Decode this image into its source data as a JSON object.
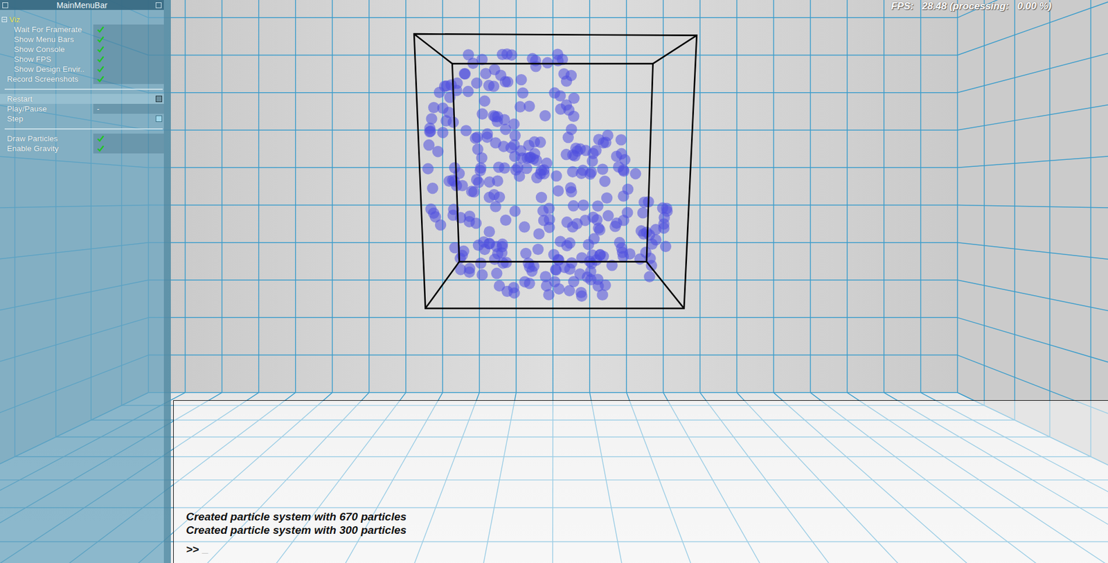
{
  "panel": {
    "title": "MainMenuBar"
  },
  "viz": {
    "label": "Viz",
    "expanded": true,
    "items": [
      {
        "label": "Wait For Framerate",
        "kind": "checkbox",
        "checked": true
      },
      {
        "label": "Show Menu Bars",
        "kind": "checkbox",
        "checked": true
      },
      {
        "label": "Show Console",
        "kind": "checkbox",
        "checked": true
      },
      {
        "label": "Show FPS",
        "kind": "checkbox",
        "checked": true
      },
      {
        "label": "Show Design Envir..",
        "kind": "checkbox",
        "checked": true
      }
    ]
  },
  "items": [
    {
      "label": "Record Screenshots",
      "kind": "checkbox",
      "checked": true
    },
    {
      "kind": "separator"
    },
    {
      "label": "Restart",
      "kind": "button",
      "highlighted": true
    },
    {
      "label": "Play/Pause",
      "kind": "field",
      "value": "-"
    },
    {
      "label": "Step",
      "kind": "button",
      "highlighted": false
    },
    {
      "kind": "separator"
    },
    {
      "label": "Draw Particles",
      "kind": "checkbox",
      "checked": true
    },
    {
      "label": "Enable Gravity",
      "kind": "checkbox",
      "checked": true
    }
  ],
  "fps": "FPS:   28.48 (processing:   0.00 %)",
  "console": {
    "lines": [
      "Created particle system with 670 particles",
      "Created particle system with 300 particles"
    ],
    "prompt": ">>",
    "cursor": "_"
  }
}
